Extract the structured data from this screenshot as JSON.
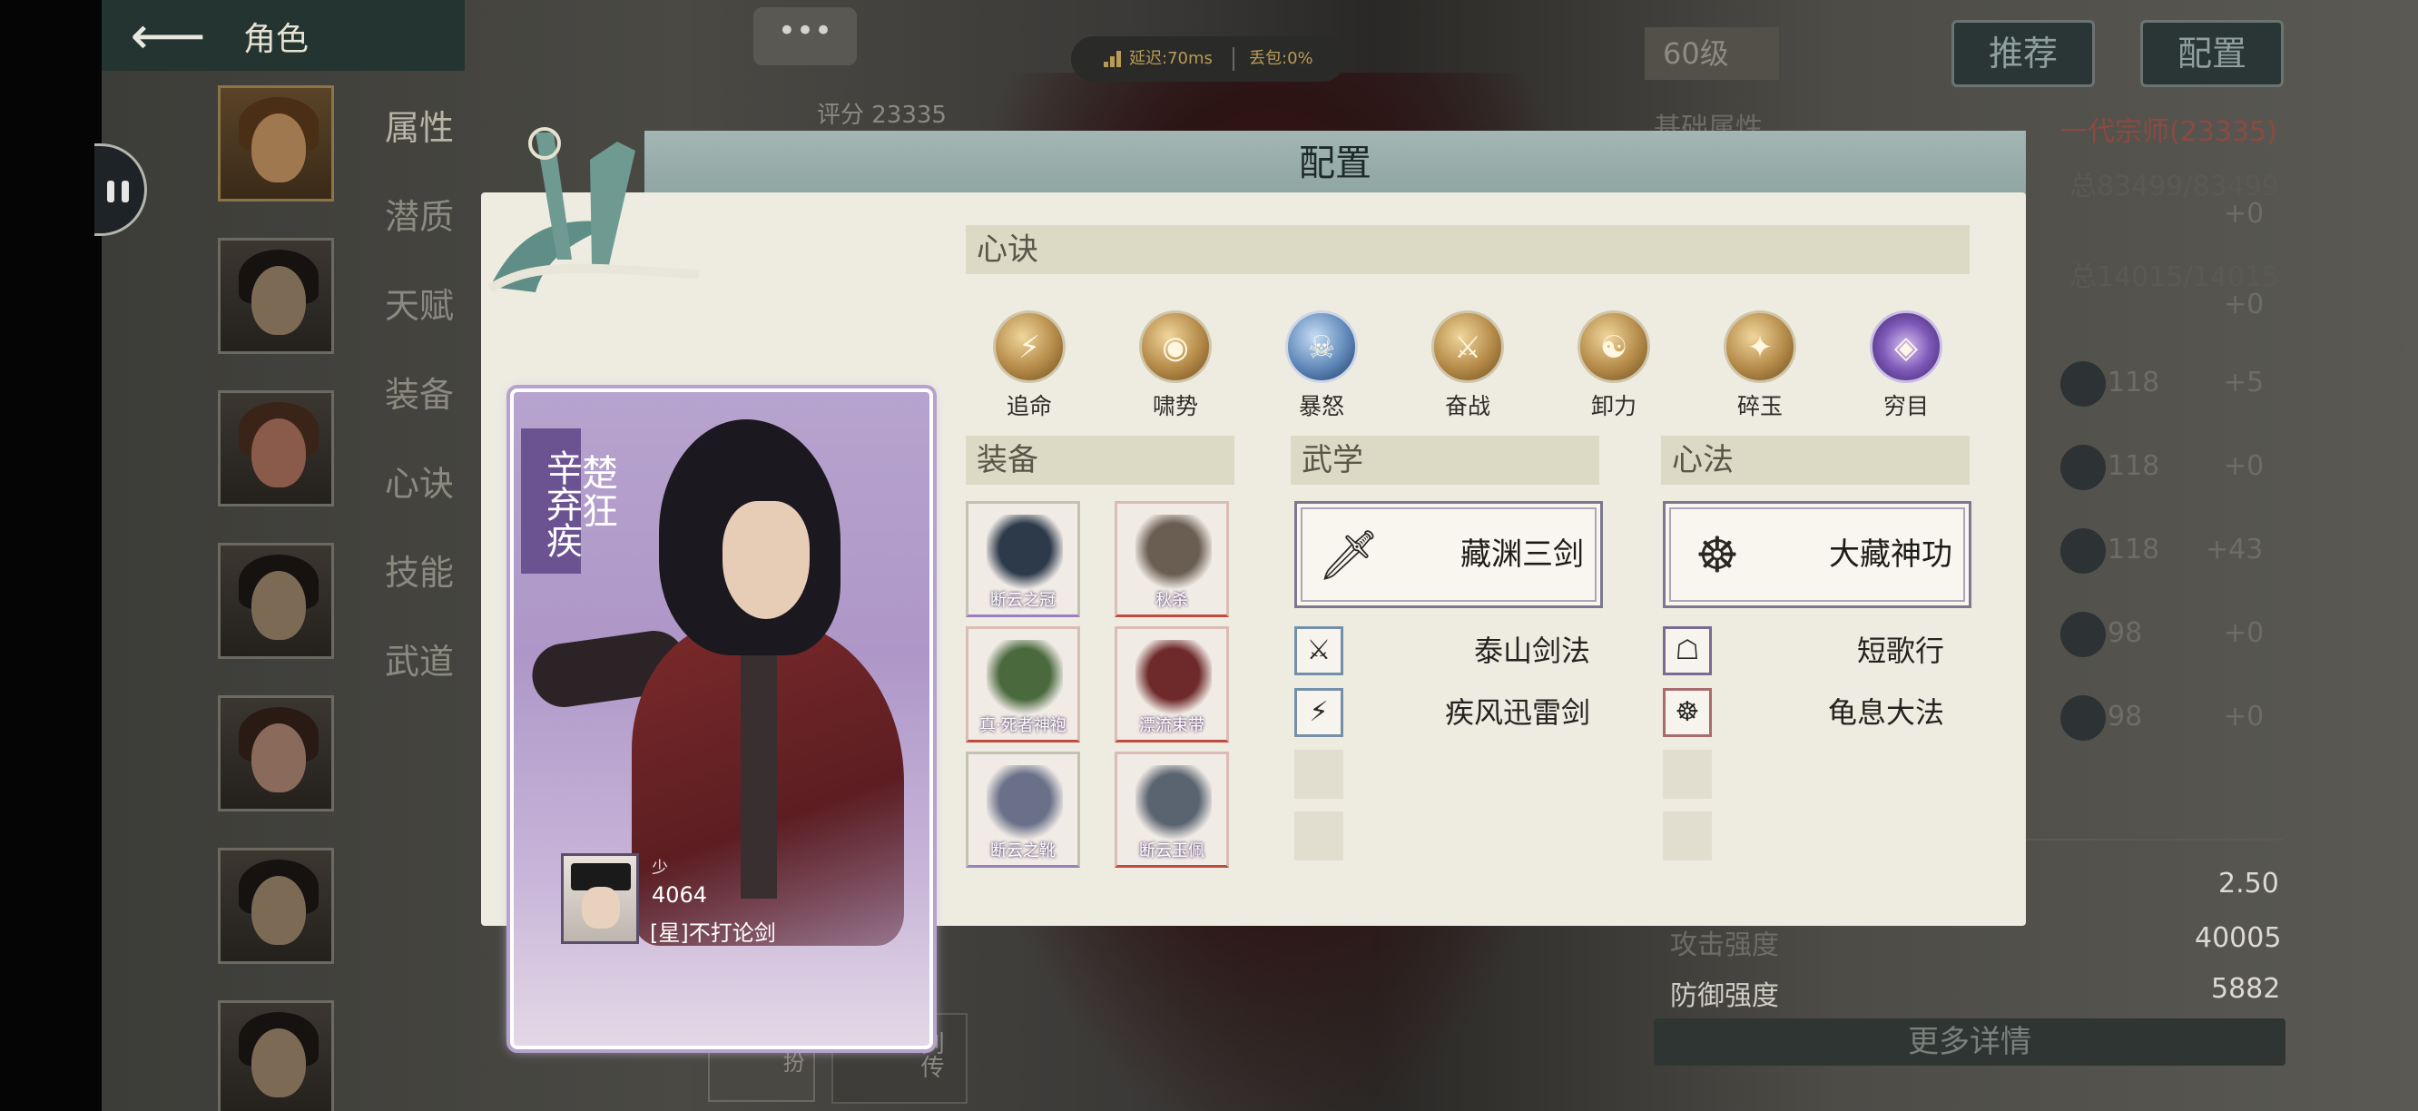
{
  "header": {
    "title": "角色",
    "back_icon": "arrow-left-icon"
  },
  "status": {
    "latency": "延迟:70ms",
    "packet_loss": "丢包:0%",
    "chat_icon": "•••"
  },
  "side_tabs": [
    "属性",
    "潜质",
    "天赋",
    "装备",
    "心诀",
    "技能",
    "武道"
  ],
  "background": {
    "rating": "评分 23335",
    "level": "60级",
    "recommend_btn": "推荐",
    "config_btn": "配置",
    "section_label": "基础属性",
    "title_rank": "一代宗师(23335)",
    "hp": "总83499/83499",
    "hp_delta": "+0",
    "mp": "总14015/14015",
    "mp_delta": "+0",
    "attrs": [
      {
        "value": "118",
        "delta": "+5"
      },
      {
        "value": "118",
        "delta": "+0"
      },
      {
        "value": "118",
        "delta": "+43"
      },
      {
        "value": "98",
        "delta": "+0"
      },
      {
        "value": "98",
        "delta": "+0"
      }
    ],
    "stat_value_1": "2.50",
    "attack_label": "攻击强度",
    "attack_value": "40005",
    "defense_label": "防御强度",
    "defense_value": "5882",
    "more_details": "更多详情",
    "bottom_btn_1": "装扮",
    "bottom_btn_2": "列传"
  },
  "dialog": {
    "title": "配置",
    "character": {
      "name": "辛弃疾",
      "title": "楚狂",
      "owner_small": "少",
      "owner_score": "4064",
      "owner_name": "[星]不打论剑"
    },
    "xinjue_section": "心诀",
    "xinjue": [
      {
        "label": "追命",
        "style": "gold",
        "glyph": "⚡"
      },
      {
        "label": "啸势",
        "style": "gold",
        "glyph": "◉"
      },
      {
        "label": "暴怒",
        "style": "blue",
        "glyph": "☠"
      },
      {
        "label": "奋战",
        "style": "gold",
        "glyph": "⚔"
      },
      {
        "label": "卸力",
        "style": "gold",
        "glyph": "☯"
      },
      {
        "label": "碎玉",
        "style": "gold",
        "glyph": "✦"
      },
      {
        "label": "穷目",
        "style": "purple",
        "glyph": "◈"
      }
    ],
    "equip_section": "装备",
    "equipment": [
      {
        "name": "断云之冠",
        "rarity": "purple",
        "color": "#2c3a4a"
      },
      {
        "name": "秋杀",
        "rarity": "red",
        "color": "#6a5e52"
      },
      {
        "name": "真·死者神袍",
        "rarity": "red",
        "color": "#4a6a3e"
      },
      {
        "name": "漂流束带",
        "rarity": "red",
        "color": "#6e2a2a"
      },
      {
        "name": "断云之靴",
        "rarity": "purple",
        "color": "#6a7088"
      },
      {
        "name": "断云玉佩",
        "rarity": "red",
        "color": "#5a6470"
      }
    ],
    "wuxue_section": "武学",
    "wuxue_main": {
      "name": "藏渊三剑",
      "icon": "sword-dancer-icon"
    },
    "wuxue_list": [
      {
        "name": "泰山剑法",
        "icon": "sword-icon"
      },
      {
        "name": "疾风迅雷剑",
        "icon": "lightning-sword-icon"
      }
    ],
    "xinfa_section": "心法",
    "xinfa_main": {
      "name": "大藏神功",
      "icon": "meditation-icon"
    },
    "xinfa_list": [
      {
        "name": "短歌行",
        "icon": "scroll-icon"
      },
      {
        "name": "龟息大法",
        "icon": "meditation-icon"
      }
    ]
  }
}
